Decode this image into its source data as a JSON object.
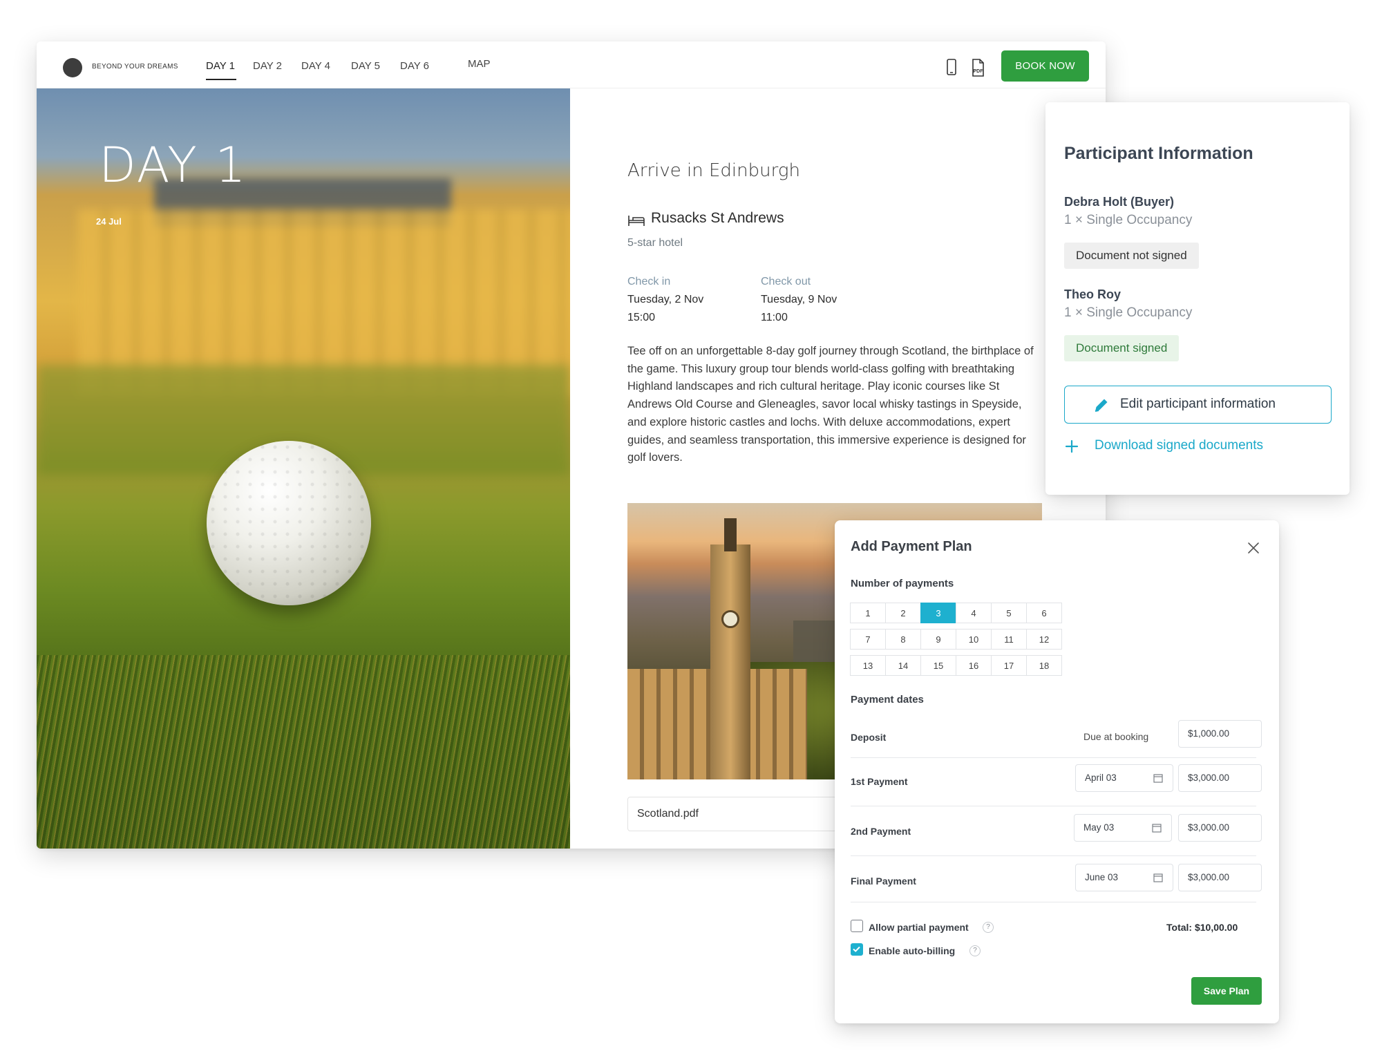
{
  "brand": {
    "name": "BEYOND YOUR DREAMS"
  },
  "nav": {
    "tabs": [
      "DAY 1",
      "DAY 2",
      "DAY 4",
      "DAY 5",
      "DAY 6",
      "MAP"
    ],
    "active_tab": "DAY 1",
    "icons": [
      "mobile-icon",
      "pdf-icon"
    ],
    "pdf_label": "PDF",
    "book_label": "BOOK NOW"
  },
  "hero": {
    "day": "DAY 1",
    "date": "24 Jul"
  },
  "detail": {
    "title": "Arrive in Edinburgh",
    "hotel_name": "Rusacks St Andrews",
    "hotel_stars": "5-star hotel",
    "check_in": {
      "label": "Check in",
      "date": "Tuesday, 2 Nov",
      "time": "15:00"
    },
    "check_out": {
      "label": "Check out",
      "date": "Tuesday, 9 Nov",
      "time": "11:00"
    },
    "description": "Tee off on an unforgettable 8-day golf journey through Scotland, the birthplace of the game. This luxury group tour blends world-class golfing with breathtaking Highland landscapes and rich cultural heritage. Play iconic courses like St Andrews Old Course and Gleneagles, savor local whisky tastings in Speyside, and explore historic castles and lochs. With deluxe accommodations, expert guides, and seamless transportation, this immersive experience is designed for golf lovers.",
    "attachment": "Scotland.pdf"
  },
  "participants": {
    "title": "Participant Information",
    "people": [
      {
        "name": "Debra Holt (Buyer)",
        "occupancy": "1 × Single Occupancy",
        "status": "Document not signed"
      },
      {
        "name": "Theo Roy",
        "occupancy": "1 × Single Occupancy",
        "status": "Document signed"
      }
    ],
    "edit_label": "Edit participant information",
    "download_label": "Download signed documents"
  },
  "payment": {
    "title": "Add Payment Plan",
    "number_label": "Number of payments",
    "numbers": [
      "1",
      "2",
      "3",
      "4",
      "5",
      "6",
      "7",
      "8",
      "9",
      "10",
      "11",
      "12",
      "13",
      "14",
      "15",
      "16",
      "17",
      "18"
    ],
    "selected_number": "3",
    "dates_label": "Payment dates",
    "deposit": {
      "label": "Deposit",
      "due": "Due at booking",
      "amount": "$1,000.00"
    },
    "rows": [
      {
        "label": "1st Payment",
        "date": "April 03",
        "amount": "$3,000.00"
      },
      {
        "label": "2nd Payment",
        "date": "May 03",
        "amount": "$3,000.00"
      },
      {
        "label": "Final Payment",
        "date": "June 03",
        "amount": "$3,000.00"
      }
    ],
    "allow_partial": {
      "label": "Allow partial payment",
      "checked": false
    },
    "auto_billing": {
      "label": "Enable auto-billing",
      "checked": true
    },
    "help_glyph": "?",
    "total": "Total: $10,00.00",
    "save_label": "Save Plan"
  },
  "colors": {
    "accent": "#1eb0cf",
    "primary_button": "#2f9e3f",
    "signed_bg": "#e8f4e8"
  }
}
